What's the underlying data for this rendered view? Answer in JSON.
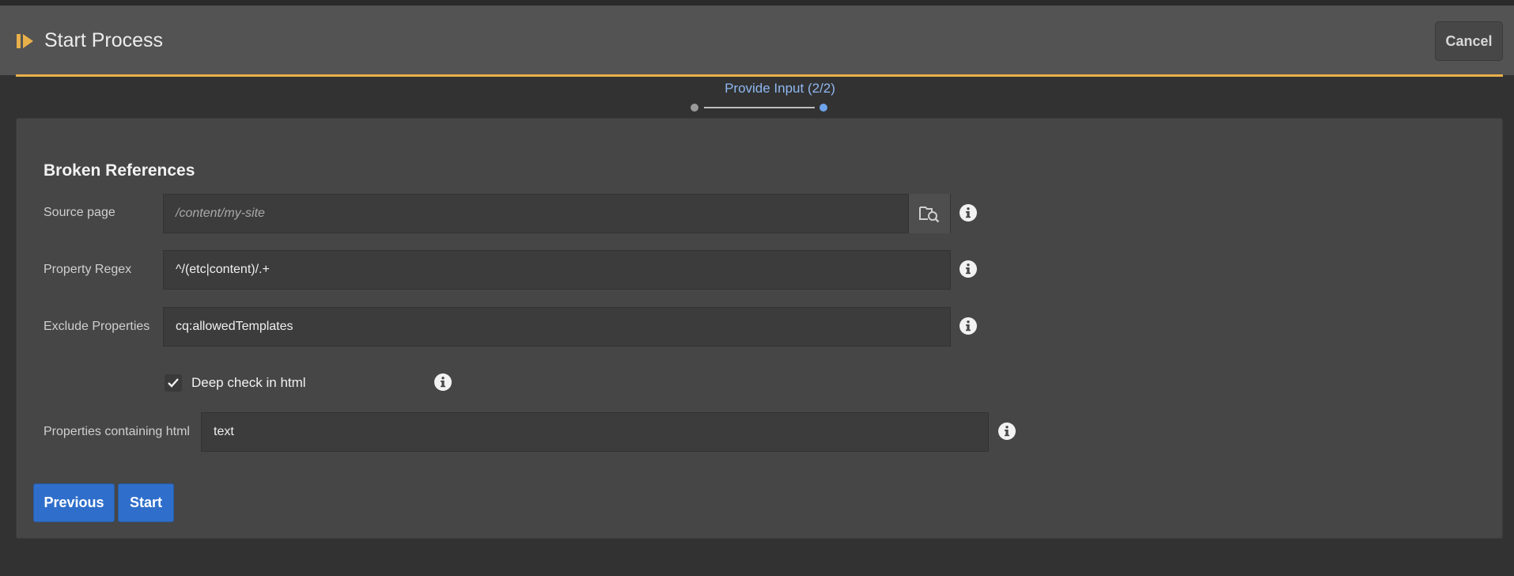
{
  "header": {
    "title": "Start Process",
    "title_icon": "play-process-icon",
    "cancel_label": "Cancel",
    "accent_color": "#e9b04a"
  },
  "stepper": {
    "label": "Provide Input (2/2)",
    "current_step": 2,
    "total_steps": 2
  },
  "form": {
    "section_title": "Broken References",
    "source_page": {
      "label": "Source page",
      "placeholder": "/content/my-site",
      "value": "",
      "browse_icon": "folder-search-icon"
    },
    "property_regex": {
      "label": "Property Regex",
      "value": "^/(etc|content)/.+"
    },
    "exclude_properties": {
      "label": "Exclude Properties",
      "value": "cq:allowedTemplates"
    },
    "deep_check": {
      "label": "Deep check in html",
      "checked": true
    },
    "properties_containing_html": {
      "label": "Properties containing html",
      "value": "text"
    }
  },
  "actions": {
    "previous_label": "Previous",
    "start_label": "Start",
    "primary_color": "#2f6fcb"
  }
}
